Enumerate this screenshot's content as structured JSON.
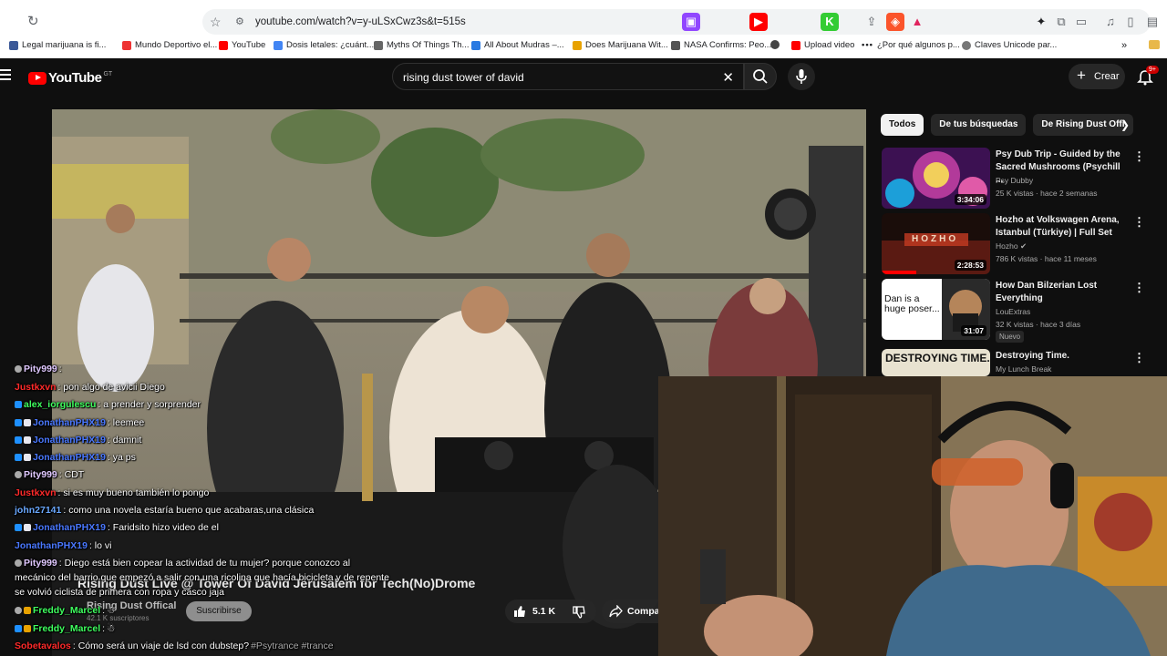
{
  "browser": {
    "url": "youtube.com/watch?v=y-uLSxCwz3s&t=515s",
    "bookmarks": [
      {
        "label": "Legal marijuana is fi...",
        "color": "#3b5998"
      },
      {
        "label": "Mundo Deportivo el...",
        "color": "#e33"
      },
      {
        "label": "YouTube",
        "color": "#ff0000"
      },
      {
        "label": "Dosis letales: ¿cuánt...",
        "color": "#4285f4"
      },
      {
        "label": "Myths Of Things Th...",
        "color": "#666"
      },
      {
        "label": "All About Mudras –...",
        "color": "#2a7ae2"
      },
      {
        "label": "Does Marijuana Wit...",
        "color": "#e8a200"
      },
      {
        "label": "NASA Confirms: Peo...",
        "color": "#555"
      },
      {
        "label": "",
        "color": "#444"
      },
      {
        "label": "Upload video",
        "color": "#ff0000"
      },
      {
        "label": "¿Por qué algunos p...",
        "color": "#333"
      },
      {
        "label": "Claves Unicode par...",
        "color": "#777"
      }
    ]
  },
  "header": {
    "logo_text": "YouTube",
    "logo_country": "GT",
    "search_value": "rising dust tower of david",
    "create_label": "Crear",
    "notifications_badge": "9+"
  },
  "chips": [
    "Todos",
    "De tus búsquedas",
    "De Rising Dust Offi"
  ],
  "recommendations": [
    {
      "title": "Psy Dub Trip - Guided by the Sacred Mushrooms (Psychill ...",
      "channel": "Psy Dubby",
      "meta": "25 K vistas · hace 2 semanas",
      "duration": "3:34:06",
      "colors": [
        "#6a1a8c",
        "#e05aa8",
        "#1c9fd9"
      ]
    },
    {
      "title": "Hozho at Volkswagen Arena, Istanbul (Türkiye) | Full Set",
      "channel": "Hozho",
      "meta": "786 K vistas · hace 11 meses",
      "duration": "2:28:53",
      "colors": [
        "#1a0d0a",
        "#c43b22",
        "#f0d8c0"
      ]
    },
    {
      "title": "How Dan Bilzerian Lost Everything",
      "channel": "LouExtras",
      "meta": "32 K vistas · hace 3 días",
      "duration": "31:07",
      "badge": "Nuevo",
      "thumb_text": "Dan is a huge poser...",
      "colors": [
        "#ffffff",
        "#1a1a1a",
        "#b5855a"
      ]
    },
    {
      "title": "Destroying Time.",
      "channel": "My Lunch Break",
      "meta": "",
      "duration": "",
      "thumb_text": "DESTROYING TIME.",
      "colors": [
        "#e8e2d0",
        "#1b1b1b",
        "#8a7a60"
      ]
    }
  ],
  "player": {
    "title": "Rising Dust Live @ Tower Of David Jerusalem for Tech(No)Drome",
    "channel": "Rising Dust Offical",
    "subscribers": "42.1 K suscriptores",
    "subscribe_label": "Suscribirse",
    "likes": "5.1 K",
    "share_label": "Compar"
  },
  "chat": [
    {
      "name": "Pity999",
      "text": ":",
      "color": "#e0c8ff",
      "badge": "#aaaaaa"
    },
    {
      "name": "Justkxvn",
      "text": ": pon algo de avicii Diego",
      "color": "#ff2a2a",
      "badge": ""
    },
    {
      "name": "alex_iorgulescu",
      "text": ": a prender y sorprender",
      "color": "#3fff5f",
      "badge": "#1e90ff"
    },
    {
      "name": "JonathanPHX19",
      "text": ": leemee",
      "color": "#4a78ff",
      "badge": "#1e90ff"
    },
    {
      "name": "JonathanPHX19",
      "text": ": damnit",
      "color": "#4a78ff",
      "badge": "#1e90ff"
    },
    {
      "name": "JonathanPHX19",
      "text": ": ya ps",
      "color": "#4a78ff",
      "badge": "#1e90ff"
    },
    {
      "name": "Pity999",
      "text": ": CDT",
      "color": "#e0c8ff",
      "badge": "#aaaaaa"
    },
    {
      "name": "Justkxvn",
      "text": ": si es muy bueno también lo pongo",
      "color": "#ff2a2a",
      "badge": ""
    },
    {
      "name": "john27141",
      "text": ": como una novela estaría bueno que acabaras,una clásica",
      "color": "#6aa8ff",
      "badge": ""
    },
    {
      "name": "JonathanPHX19",
      "text": ": Faridsito hizo video de el",
      "color": "#4a78ff",
      "badge": "#1e90ff"
    },
    {
      "name": "JonathanPHX19",
      "text": ": lo vi",
      "color": "#4a78ff",
      "badge": ""
    },
    {
      "name": "Pity999",
      "text": ": Diego está bien copear la actividad de tu mujer? porque conozco al",
      "color": "#e0c8ff",
      "badge": "#aaaaaa"
    },
    {
      "name": "",
      "text": "mecánico del barrio que empezó a salir con una ricolina que hacía bicicleta y de repente",
      "color": "#ffffff",
      "badge": ""
    },
    {
      "name": "",
      "text": "se volvió ciclista de primera con ropa y casco jaja",
      "color": "#ffffff",
      "badge": ""
    },
    {
      "name": "Freddy_Marcel",
      "text": ":",
      "color": "#3fff5f",
      "badge": "#1e90ff"
    },
    {
      "name": "Freddy_Marcel",
      "text": ":",
      "color": "#3fff5f",
      "badge": "#1e90ff"
    },
    {
      "name": "Sobetavalos",
      "text": ": Cómo será un viaje de lsd con dubstep?",
      "color": "#ff2a2a",
      "badge": ""
    }
  ],
  "chat_tail": "#Psytrance #trance"
}
